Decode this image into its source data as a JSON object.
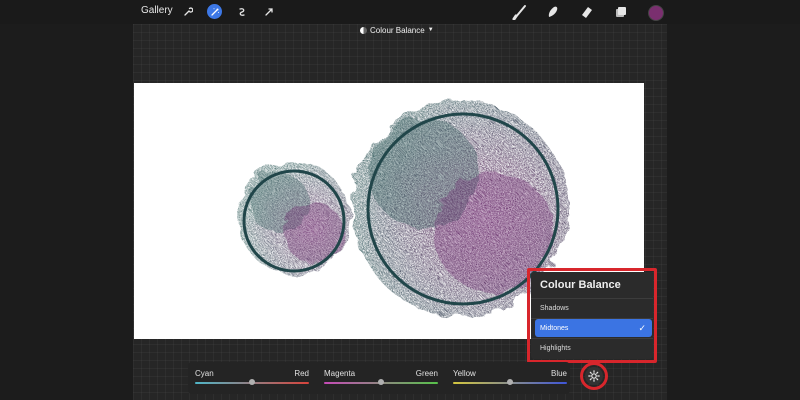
{
  "topbar": {
    "gallery_label": "Gallery",
    "left_tools": [
      {
        "icon": "wrench-icon"
      },
      {
        "icon": "magic-wand-icon",
        "active": true
      },
      {
        "icon": "selection-icon"
      },
      {
        "icon": "transform-arrow-icon"
      }
    ],
    "right_tools": [
      {
        "icon": "brush-icon"
      },
      {
        "icon": "smudge-icon"
      },
      {
        "icon": "eraser-icon"
      },
      {
        "icon": "layers-icon"
      }
    ],
    "color_swatch": "#7a2f6f"
  },
  "title_bar": {
    "label": "Colour Balance",
    "chevron": "▼"
  },
  "popup": {
    "title": "Colour Balance",
    "items": [
      {
        "label": "Shadows",
        "selected": false
      },
      {
        "label": "Midtones",
        "selected": true,
        "check": "✓"
      },
      {
        "label": "Highlights",
        "selected": false
      }
    ]
  },
  "sliders": [
    {
      "left_label": "Cyan",
      "right_label": "Red",
      "value": 0.5,
      "gradient": [
        "#4fb6c7",
        "#d7433b"
      ]
    },
    {
      "left_label": "Magenta",
      "right_label": "Green",
      "value": 0.5,
      "gradient": [
        "#c64bb7",
        "#57c24a"
      ]
    },
    {
      "left_label": "Yellow",
      "right_label": "Blue",
      "value": 0.5,
      "gradient": [
        "#d3c63f",
        "#3e55d8"
      ]
    }
  ],
  "settings_icon": "gear-icon",
  "highlight_color": "#d8262c",
  "accent_color": "#3b74e3"
}
